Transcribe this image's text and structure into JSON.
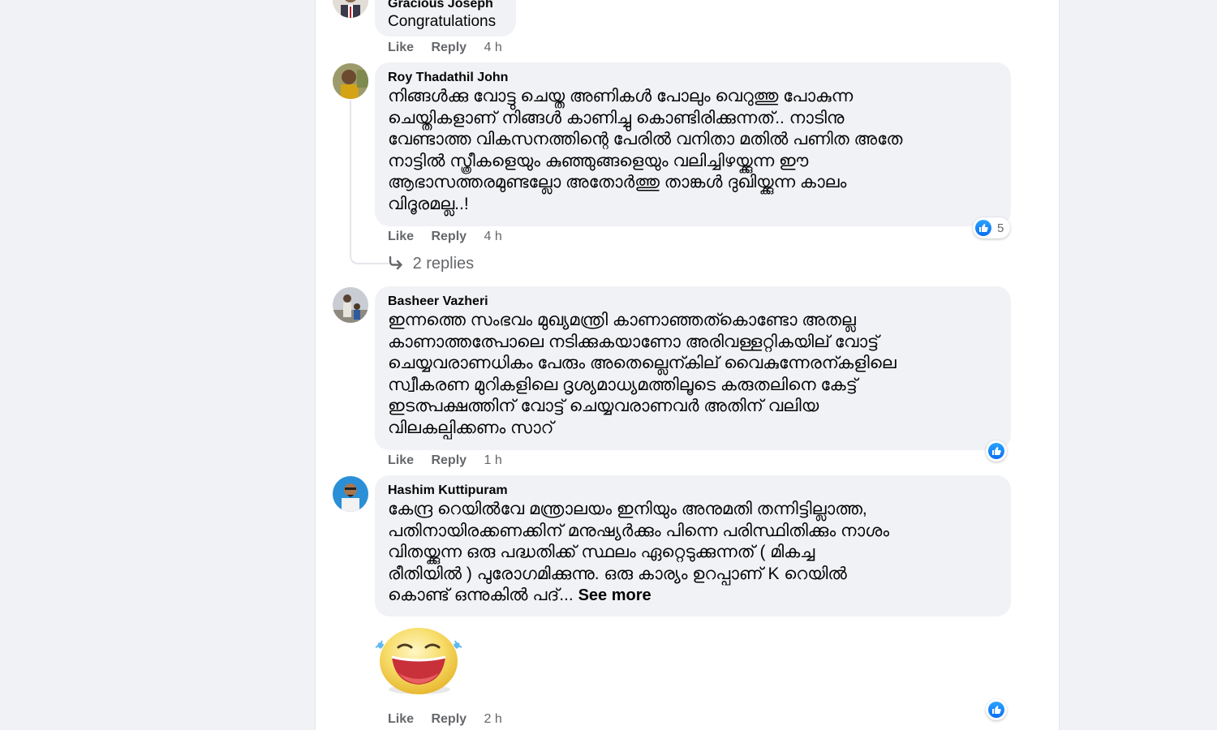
{
  "comments": [
    {
      "author": "Gracious Joseph",
      "text": "Congratulations",
      "actions": {
        "like": "Like",
        "reply": "Reply",
        "time": "4 h"
      }
    },
    {
      "author": "Roy Thadathil John",
      "text": "നിങ്ങൾക്കു വോട്ടു ചെയ്ത അണികൾ പോലും വെറുത്തു പോകുന്ന\nചെയ്തികളാണ് നിങ്ങൾ കാണിച്ചു കൊണ്ടിരിക്കുന്നത്.. നാടിനു\nവേണ്ടാത്ത വികസനത്തിന്റെ പേരിൽ വനിതാ മതിൽ പണിത അതേ\nനാട്ടിൽ സ്ത്രീകളെയും കുഞ്ഞുങ്ങളെയും വലിച്ചിഴയ്ക്കുന്ന ഈ\nആഭാസത്തരമുണ്ടല്ലോ അതോർത്തു താങ്കൾ ദുഖിയ്ക്കുന്ന കാലം\nവിദൂരമല്ല..!",
      "reaction_count": "5",
      "actions": {
        "like": "Like",
        "reply": "Reply",
        "time": "4 h"
      },
      "replies_label": "2 replies"
    },
    {
      "author": "Basheer Vazheri",
      "text": "ഇന്നത്തെ സംഭവം മുഖ്യമന്ത്രി കാണാഞ്ഞത്കൊണ്ടോ അതല്ല\nകാണാത്തത്പോലെ നടിക്കുകയാണോ അരിവള്ളറ്റികയില് വോട്ട്\nചെയ്യവരാണധികം പേരും അതെല്ലെന്കില് വൈകുന്നേരന്കളിലെ\nസ്വീകരണ മുറികളിലെ ദൃശ്യമാധ്യമത്തിലൂടെ കരുതലിനെ കേട്ട്\nഇടത്പക്ഷത്തിന് വോട്ട് ചെയ്യവരാണവർ അതിന് വലിയ\nവിലകല്പിക്കണം സാറ്",
      "actions": {
        "like": "Like",
        "reply": "Reply",
        "time": "1 h"
      }
    },
    {
      "author": "Hashim Kuttipuram",
      "text": "കേന്ദ്ര റെയിൽവേ മന്ത്രാലയം ഇനിയും അനുമതി തന്നിട്ടില്ലാത്ത,\nപതിനായിരക്കണക്കിന് മനുഷ്യർക്കും പിന്നെ പരിസ്ഥിതിക്കും നാശം\nവിതയ്ക്കുന്ന ഒരു പദ്ധതിക്ക് സ്ഥലം ഏറ്റെടുക്കുന്നത് ( മികച്ച\nരീതിയിൽ ) പുരോഗമിക്കുന്നു. ഒരു കാര്യം ഉറപ്പാണ് K റെയിൽ\nകൊണ്ട് ഒന്നുകിൽ പദ്...",
      "see_more": "See more"
    },
    {
      "sticker": "laughing-face-sticker",
      "actions": {
        "like": "Like",
        "reply": "Reply",
        "time": "2 h"
      }
    }
  ],
  "colors": {
    "page_bg": "#f0f2f5",
    "bubble_bg": "#f0f2f5",
    "meta_text": "#65676b",
    "like_blue": "#1877f2"
  }
}
